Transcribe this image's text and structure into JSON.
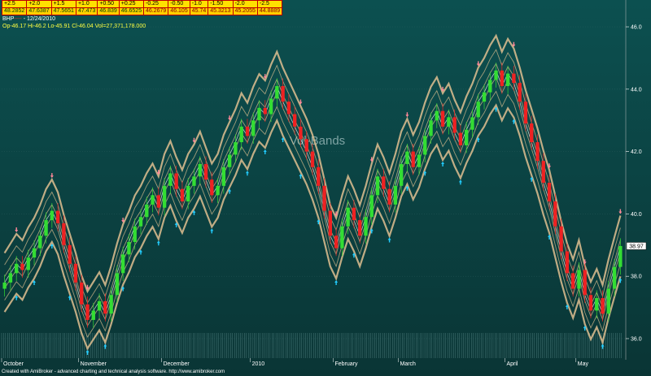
{
  "header": {
    "left_pct": [
      "+2.5",
      "+2.0",
      "+1.5",
      "+1.0",
      "+0.50",
      "+0.25"
    ],
    "left_vals": [
      "48.2852",
      "47.6387",
      "47.5651",
      "47.473",
      "46.839",
      "46.6525"
    ],
    "right_pct": [
      "-0.25",
      "-0.50",
      "-1.0",
      "-1.50",
      "-2.0",
      "-2.5"
    ],
    "right_vals": [
      "46.2679",
      "46.105",
      "45.74",
      "45.3213",
      "45.2055",
      "44.8889"
    ]
  },
  "symbol": {
    "ticker": "BHP",
    "flag": "----",
    "date": "- 12/24/2010"
  },
  "ohlc_line": "Op-46.17  Hi-46.2  Lo-45.91  Cl-46.04  Vol=27,371,178.000",
  "watermark": "Vol-Bands",
  "last_price": "38.97",
  "footer": "Created with AmiBroker - advanced charting and technical analysis software. http://www.amibroker.com",
  "colors": {
    "bg_top": "#0a4a4a",
    "bg_bottom": "#0b3a3a",
    "up": "#33dd33",
    "down": "#ee2222",
    "band": "#e0c090",
    "mid_band": "#ffffff",
    "arrow_up": "#22ccff",
    "arrow_down": "#ff8899"
  },
  "chart_data": {
    "type": "candlestick",
    "y_ticks": [
      36.0,
      38.0,
      40.0,
      42.0,
      44.0,
      46.0
    ],
    "ylim": [
      35.4,
      46.6
    ],
    "x_labels": [
      "October",
      "November",
      "December",
      "2010",
      "February",
      "March",
      "April",
      "May"
    ],
    "close": [
      37.8,
      38.1,
      38.4,
      38.2,
      38.6,
      38.9,
      39.3,
      39.8,
      40.1,
      39.7,
      39.0,
      38.4,
      37.8,
      37.1,
      36.6,
      36.9,
      37.2,
      36.8,
      37.4,
      38.1,
      38.7,
      39.1,
      39.6,
      39.9,
      40.3,
      40.6,
      40.2,
      40.9,
      41.3,
      40.8,
      40.4,
      40.9,
      41.2,
      41.6,
      41.1,
      40.6,
      40.9,
      41.5,
      41.9,
      42.3,
      42.8,
      42.5,
      43.0,
      43.4,
      43.2,
      43.7,
      44.1,
      43.6,
      43.2,
      42.8,
      42.4,
      42.0,
      41.5,
      40.9,
      40.1,
      39.3,
      38.9,
      39.6,
      40.2,
      39.8,
      39.3,
      39.9,
      40.6,
      41.2,
      40.8,
      40.3,
      40.9,
      41.6,
      42.0,
      41.5,
      41.9,
      42.5,
      43.0,
      43.3,
      42.8,
      43.1,
      42.6,
      42.2,
      42.7,
      43.1,
      43.6,
      43.9,
      44.3,
      44.6,
      44.1,
      44.5,
      44.2,
      43.6,
      42.9,
      42.3,
      41.7,
      41.0,
      40.4,
      39.6,
      38.8,
      38.1,
      37.6,
      38.2,
      37.4,
      36.9,
      37.3,
      36.8,
      37.6,
      38.3,
      38.97
    ],
    "series": [
      {
        "name": "+2.5",
        "offset_pct": 2.5
      },
      {
        "name": "+1.5",
        "offset_pct": 1.5
      },
      {
        "name": "+0.50",
        "offset_pct": 0.5
      },
      {
        "name": "-0.50",
        "offset_pct": -0.5
      },
      {
        "name": "-1.50",
        "offset_pct": -1.5
      },
      {
        "name": "-2.5",
        "offset_pct": -2.5
      }
    ]
  }
}
